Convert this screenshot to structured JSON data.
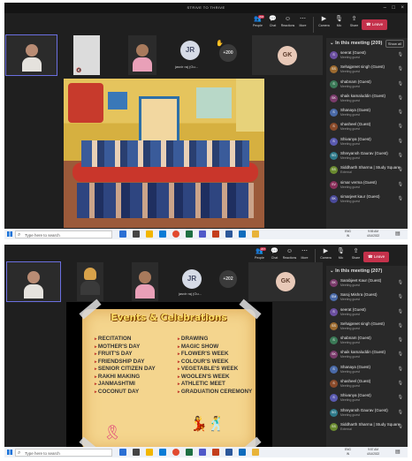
{
  "window_title": "STRIVE TO THRIVE",
  "toolbar": {
    "people": {
      "label": "People",
      "badge": "208"
    },
    "people_2": {
      "label": "People",
      "badge": "207"
    },
    "chat": "Chat",
    "reactions": "Reactions",
    "more": "More",
    "camera": "Camera",
    "mic": "Mic",
    "share": "Share",
    "leave": "Leave"
  },
  "shot1": {
    "plus_count": "+200",
    "stage_name": "ARCHANA MALHOTRA",
    "tile_name_jr": "jasvir raj (Gu...",
    "panel_title": "In this meeting (209)",
    "show_all": "Show all",
    "participants": [
      {
        "initials": "S",
        "name": "seerat (Guest)",
        "status": "Meeting guest",
        "color": "#6b4fa0"
      },
      {
        "initials": "SS",
        "name": "Sehajpreet singh (Guest)",
        "status": "Meeting guest",
        "color": "#9c6a2f"
      },
      {
        "initials": "S",
        "name": "shabnam (Guest)",
        "status": "Meeting guest",
        "color": "#3b7a57"
      },
      {
        "initials": "SK",
        "name": "shaik kamaluddin (Guest)",
        "status": "Meeting guest",
        "color": "#7a3b6b"
      },
      {
        "initials": "S",
        "name": "Shanaya (Guest)",
        "status": "Meeting guest",
        "color": "#4a6aa8"
      },
      {
        "initials": "S",
        "name": "shasheel (Guest)",
        "status": "Meeting guest",
        "color": "#8a4a2a"
      },
      {
        "initials": "S",
        "name": "Shivanya (Guest)",
        "status": "Meeting guest",
        "color": "#5a5ab0"
      },
      {
        "initials": "SG",
        "name": "Shreyansh Gaurav (Guest)",
        "status": "Meeting guest",
        "color": "#2f7a8a"
      },
      {
        "initials": "SS",
        "name": "Siddharth Sharma | Study Square",
        "status": "External",
        "color": "#6a8a2f"
      },
      {
        "initials": "SV",
        "name": "simar verma (Guest)",
        "status": "Meeting guest",
        "color": "#8a2f5a"
      },
      {
        "initials": "SK",
        "name": "simarjeet kaur (Guest)",
        "status": "Meeting guest",
        "color": "#4a4a9a"
      }
    ],
    "taskbar_search": "Type here to search",
    "tray_lang": "ENG",
    "tray_region": "IN",
    "time": "9:55 AM",
    "date": "4/14/2022"
  },
  "shot2": {
    "plus_count": "+202",
    "stage_name": "ARCHANA MALHOTRA",
    "tile_name_jr": "jasvir raj (Gu...",
    "panel_title": "In this meeting (207)",
    "show_all": "Show all",
    "slide": {
      "title": "Events & Celebrations",
      "left": [
        "RECITATION",
        "MOTHER'S DAY",
        "FRUIT'S DAY",
        "FRIENDSHIP DAY",
        "SENIOR CITIZEN DAY",
        "RAKHI MAKING",
        "JANMASHTMI",
        "COCONUT DAY"
      ],
      "right": [
        "DRAWING",
        "MAGIC SHOW",
        "FLOWER'S WEEK",
        "COLOUR'S WEEK",
        "VEGETABLE'S WEEK",
        "WOOLEN'S WEEK",
        "ATHLETIC MEET",
        "GRADUATION CEREMONY"
      ]
    },
    "participants": [
      {
        "initials": "SK",
        "name": "Sarabjeet Kaur (Guest)",
        "status": "Meeting guest",
        "color": "#7a3b6b"
      },
      {
        "initials": "SM",
        "name": "Saroj Mishra (Guest)",
        "status": "Meeting guest",
        "color": "#4a6aa8"
      },
      {
        "initials": "S",
        "name": "seerat (Guest)",
        "status": "Meeting guest",
        "color": "#6b4fa0"
      },
      {
        "initials": "SS",
        "name": "Sehajpreet singh (Guest)",
        "status": "Meeting guest",
        "color": "#9c6a2f"
      },
      {
        "initials": "S",
        "name": "shabnam (Guest)",
        "status": "Meeting guest",
        "color": "#3b7a57"
      },
      {
        "initials": "SK",
        "name": "shaik kamaluddin (Guest)",
        "status": "Meeting guest",
        "color": "#7a3b6b"
      },
      {
        "initials": "S",
        "name": "Shanaya (Guest)",
        "status": "Meeting guest",
        "color": "#4a6aa8"
      },
      {
        "initials": "S",
        "name": "shasheel (Guest)",
        "status": "Meeting guest",
        "color": "#8a4a2a"
      },
      {
        "initials": "S",
        "name": "Shivanya (Guest)",
        "status": "Meeting guest",
        "color": "#5a5ab0"
      },
      {
        "initials": "SG",
        "name": "Shreyansh Gaurav (Guest)",
        "status": "Meeting guest",
        "color": "#2f7a8a"
      },
      {
        "initials": "SS",
        "name": "Siddharth Sharma | Study Square",
        "status": "External",
        "color": "#6a8a2f"
      }
    ],
    "taskbar_search": "Type here to search",
    "tray_lang": "ENG",
    "tray_region": "IN",
    "time": "9:57 AM",
    "date": "4/14/2022"
  },
  "gk_initials": "GK",
  "jr_initials": "JR",
  "colors": {
    "leave_red": "#c4314b",
    "teams_purple": "#6b6fe0",
    "panel_bg": "#292929"
  }
}
